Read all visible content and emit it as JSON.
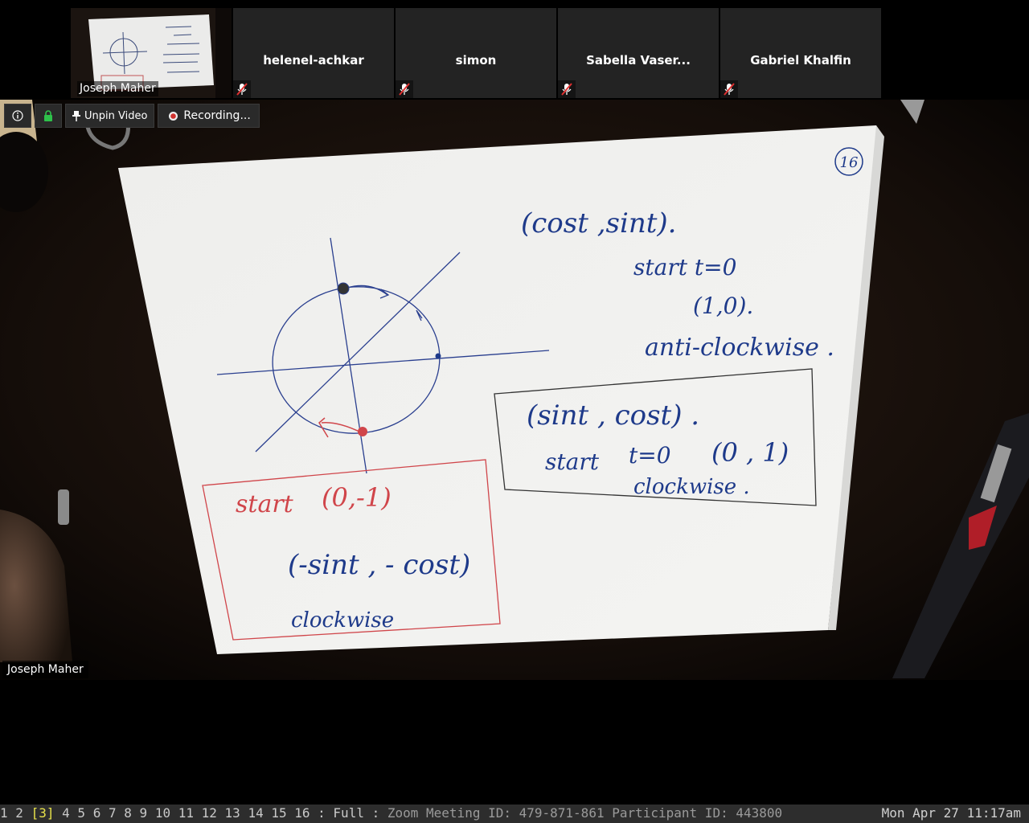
{
  "thumbnail": {
    "name": "Joseph Maher"
  },
  "participants": [
    {
      "name": "helenel-achkar",
      "muted": true
    },
    {
      "name": "simon",
      "muted": true
    },
    {
      "name": "Sabella Vaser...",
      "muted": true
    },
    {
      "name": "Gabriel Khalfin",
      "muted": true
    }
  ],
  "toolbar": {
    "unpin_label": "Unpin Video",
    "recording_label": "Recording..."
  },
  "main_video": {
    "name": "Joseph Maher",
    "page_number": "16",
    "notes": {
      "top_right": [
        "(cost ,sint).",
        "start t=0",
        "(1,0).",
        "anti-clockwise ."
      ],
      "box_right": [
        "(sint , cost) .",
        "start",
        "t=0",
        "(0 , 1)",
        "clockwise ."
      ],
      "box_left": [
        "start",
        "(0,-1)",
        "(-sint , - cost)",
        "clockwise"
      ]
    }
  },
  "statusbar": {
    "workspaces": [
      "1",
      "2",
      "3",
      "4",
      "5",
      "6",
      "7",
      "8",
      "9",
      "10",
      "11",
      "12",
      "13",
      "14",
      "15",
      "16"
    ],
    "active_workspace": "3",
    "mode": ": Full :",
    "info": "Zoom Meeting ID: 479-871-861 Participant ID: 443800",
    "datetime": "Mon Apr 27 11:17am"
  },
  "colors": {
    "tile_bg": "#232323",
    "active_workspace": "#e8e24a",
    "ink_blue": "#1e3a8a",
    "ink_red": "#d0454a",
    "paper": "#f1f1ef"
  }
}
